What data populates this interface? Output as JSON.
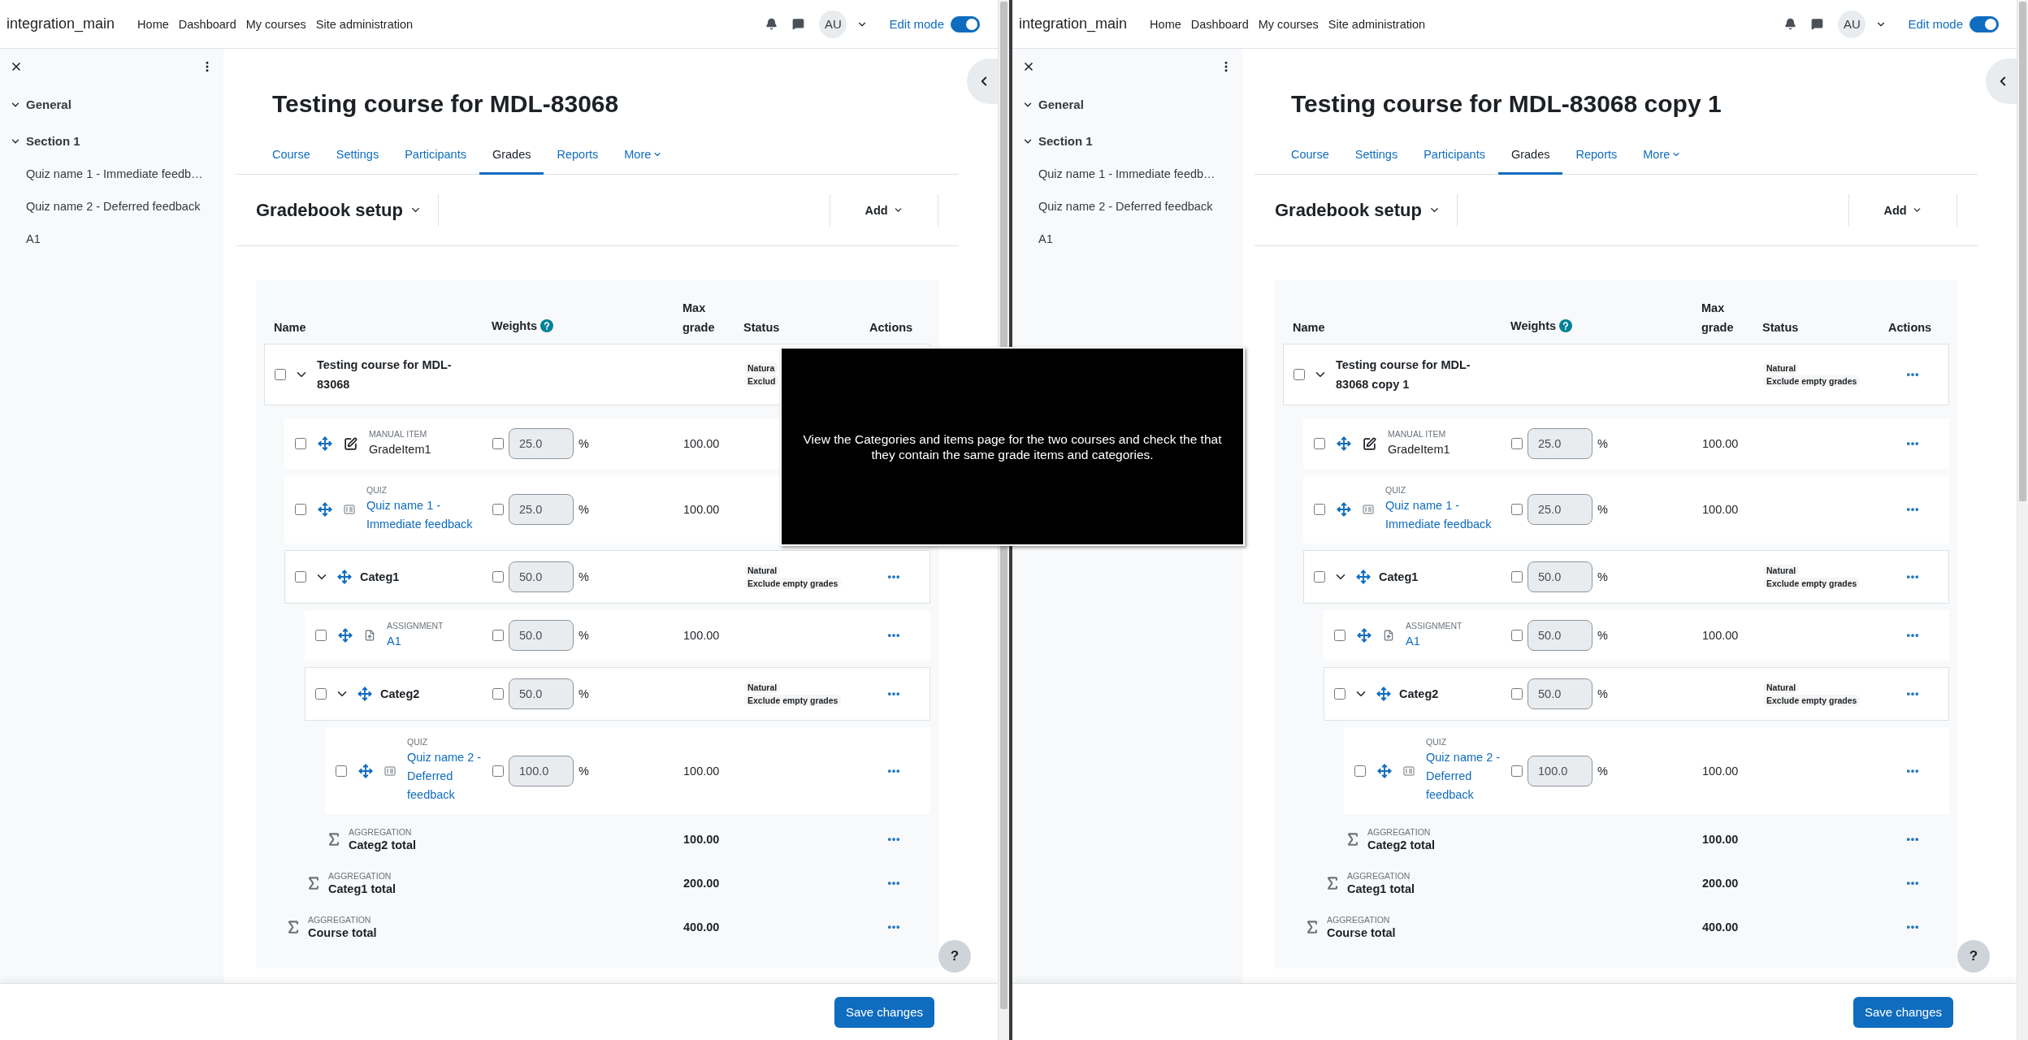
{
  "panes": [
    {
      "navbar": {
        "brand": "integration_main",
        "links": [
          "Home",
          "Dashboard",
          "My courses",
          "Site administration"
        ],
        "avatar": "AU",
        "edit_mode_label": "Edit mode",
        "edit_mode_on": true
      },
      "sidebar": {
        "sections": [
          {
            "title": "General",
            "expanded": true
          },
          {
            "title": "Section 1",
            "expanded": true,
            "items": [
              "Quiz name 1 - Immediate feedb…",
              "Quiz name 2 - Deferred feedback",
              "A1"
            ]
          }
        ]
      },
      "course_title": "Testing course for MDL-83068",
      "tabs": [
        {
          "label": "Course",
          "selected": false
        },
        {
          "label": "Settings",
          "selected": false
        },
        {
          "label": "Participants",
          "selected": false
        },
        {
          "label": "Grades",
          "selected": true
        },
        {
          "label": "Reports",
          "selected": false
        },
        {
          "label": "More",
          "selected": false,
          "dropdown": true
        }
      ],
      "page_heading": "Gradebook setup",
      "add_button": "Add",
      "table": {
        "columns": [
          "Name",
          "Weights",
          "Max grade",
          "Status",
          "Actions"
        ],
        "rows": [
          {
            "kind": "category",
            "name": "Testing course for MDL-83068",
            "checked": false,
            "expanded": true,
            "movable": false,
            "status": [
              "Natura",
              "Exclud"
            ],
            "actions": false,
            "children": [
              {
                "kind": "manual",
                "type_label": "MANUAL ITEM",
                "name": "GradeItem1",
                "checked": false,
                "override": false,
                "weight": "25.0",
                "unit": "%",
                "max_grade": "100.00",
                "actions": false
              },
              {
                "kind": "quiz",
                "type_label": "QUIZ",
                "name": "Quiz name 1 - Immediate feedback",
                "checked": false,
                "override": false,
                "weight": "25.0",
                "unit": "%",
                "max_grade": "100.00",
                "actions": false
              },
              {
                "kind": "category",
                "name": "Categ1",
                "checked": false,
                "expanded": true,
                "movable": true,
                "override": false,
                "weight": "50.0",
                "unit": "%",
                "status": [
                  "Natural",
                  "Exclude empty grades"
                ],
                "actions": true,
                "children": [
                  {
                    "kind": "assign",
                    "type_label": "ASSIGNMENT",
                    "name": "A1",
                    "checked": false,
                    "override": false,
                    "weight": "50.0",
                    "unit": "%",
                    "max_grade": "100.00",
                    "actions": true
                  },
                  {
                    "kind": "category",
                    "name": "Categ2",
                    "checked": false,
                    "expanded": true,
                    "movable": true,
                    "override": false,
                    "weight": "50.0",
                    "unit": "%",
                    "status": [
                      "Natural",
                      "Exclude empty grades"
                    ],
                    "actions": true,
                    "children": [
                      {
                        "kind": "quiz",
                        "type_label": "QUIZ",
                        "name": "Quiz name 2 - Deferred feedback",
                        "checked": false,
                        "override": false,
                        "weight": "100.0",
                        "unit": "%",
                        "max_grade": "100.00",
                        "actions": true
                      },
                      {
                        "kind": "total",
                        "type_label": "AGGREGATION",
                        "name": "Categ2 total",
                        "max_grade": "100.00",
                        "actions": true
                      }
                    ]
                  },
                  {
                    "kind": "total",
                    "type_label": "AGGREGATION",
                    "name": "Categ1 total",
                    "max_grade": "200.00",
                    "actions": true
                  }
                ]
              },
              {
                "kind": "total",
                "type_label": "AGGREGATION",
                "name": "Course total",
                "max_grade": "400.00",
                "actions": true
              }
            ]
          }
        ]
      },
      "help_button": "?",
      "save_button": "Save changes"
    },
    {
      "navbar": {
        "brand": "integration_main",
        "links": [
          "Home",
          "Dashboard",
          "My courses",
          "Site administration"
        ],
        "avatar": "AU",
        "edit_mode_label": "Edit mode",
        "edit_mode_on": true
      },
      "sidebar": {
        "sections": [
          {
            "title": "General",
            "expanded": true
          },
          {
            "title": "Section 1",
            "expanded": true,
            "items": [
              "Quiz name 1 - Immediate feedb…",
              "Quiz name 2 - Deferred feedback",
              "A1"
            ]
          }
        ]
      },
      "course_title": "Testing course for MDL-83068 copy 1",
      "tabs": [
        {
          "label": "Course",
          "selected": false
        },
        {
          "label": "Settings",
          "selected": false
        },
        {
          "label": "Participants",
          "selected": false
        },
        {
          "label": "Grades",
          "selected": true
        },
        {
          "label": "Reports",
          "selected": false
        },
        {
          "label": "More",
          "selected": false,
          "dropdown": true
        }
      ],
      "page_heading": "Gradebook setup",
      "add_button": "Add",
      "table": {
        "columns": [
          "Name",
          "Weights",
          "Max grade",
          "Status",
          "Actions"
        ],
        "rows": [
          {
            "kind": "category",
            "name": "Testing course for MDL-83068 copy 1",
            "checked": false,
            "expanded": true,
            "movable": false,
            "status": [
              "Natural",
              "Exclude empty grades"
            ],
            "actions": true,
            "children": [
              {
                "kind": "manual",
                "type_label": "MANUAL ITEM",
                "name": "GradeItem1",
                "checked": false,
                "override": false,
                "weight": "25.0",
                "unit": "%",
                "max_grade": "100.00",
                "actions": true
              },
              {
                "kind": "quiz",
                "type_label": "QUIZ",
                "name": "Quiz name 1 - Immediate feedback",
                "checked": false,
                "override": false,
                "weight": "25.0",
                "unit": "%",
                "max_grade": "100.00",
                "actions": true
              },
              {
                "kind": "category",
                "name": "Categ1",
                "checked": false,
                "expanded": true,
                "movable": true,
                "override": false,
                "weight": "50.0",
                "unit": "%",
                "status": [
                  "Natural",
                  "Exclude empty grades"
                ],
                "actions": true,
                "children": [
                  {
                    "kind": "assign",
                    "type_label": "ASSIGNMENT",
                    "name": "A1",
                    "checked": false,
                    "override": false,
                    "weight": "50.0",
                    "unit": "%",
                    "max_grade": "100.00",
                    "actions": true
                  },
                  {
                    "kind": "category",
                    "name": "Categ2",
                    "checked": false,
                    "expanded": true,
                    "movable": true,
                    "override": false,
                    "weight": "50.0",
                    "unit": "%",
                    "status": [
                      "Natural",
                      "Exclude empty grades"
                    ],
                    "actions": true,
                    "children": [
                      {
                        "kind": "quiz",
                        "type_label": "QUIZ",
                        "name": "Quiz name 2 - Deferred feedback",
                        "checked": false,
                        "override": false,
                        "weight": "100.0",
                        "unit": "%",
                        "max_grade": "100.00",
                        "actions": true
                      },
                      {
                        "kind": "total",
                        "type_label": "AGGREGATION",
                        "name": "Categ2 total",
                        "max_grade": "100.00",
                        "actions": true
                      }
                    ]
                  },
                  {
                    "kind": "total",
                    "type_label": "AGGREGATION",
                    "name": "Categ1 total",
                    "max_grade": "200.00",
                    "actions": true
                  }
                ]
              },
              {
                "kind": "total",
                "type_label": "AGGREGATION",
                "name": "Course total",
                "max_grade": "400.00",
                "actions": true
              }
            ]
          }
        ]
      },
      "help_button": "?",
      "save_button": "Save changes"
    }
  ],
  "overlay": {
    "text": "View the Categories and items page for the two courses and check the that they contain the same grade items and categories."
  }
}
